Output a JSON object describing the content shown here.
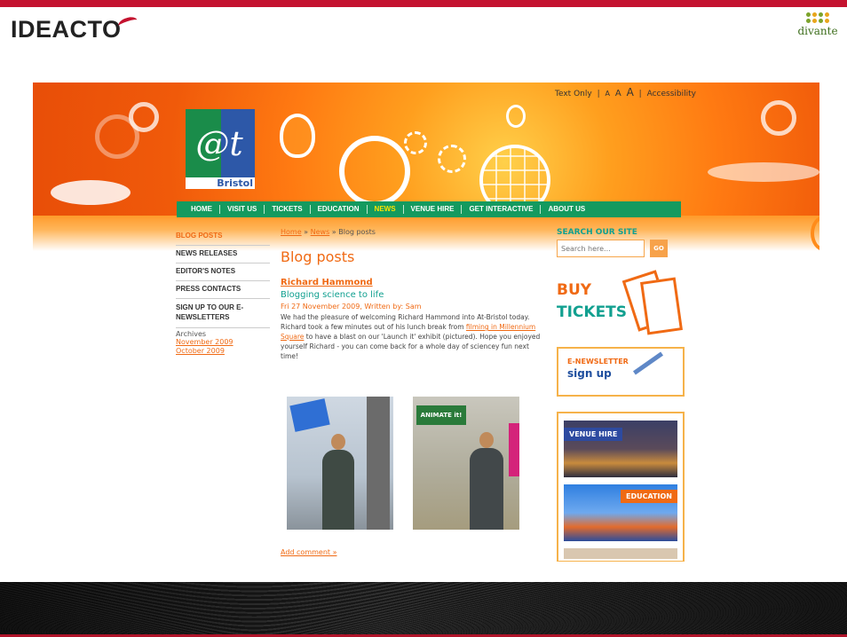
{
  "slide": {
    "logo": "IDEACTO",
    "partner": "divante"
  },
  "site": {
    "access_links": [
      "Text Only",
      "|",
      "A",
      "A",
      "A",
      "|",
      "Accessibility"
    ],
    "logo_mark": "@t",
    "logo_city": "Bristol",
    "nav": [
      "HOME",
      "VISIT US",
      "TICKETS",
      "EDUCATION",
      "NEWS",
      "VENUE HIRE",
      "GET INTERACTIVE",
      "ABOUT US"
    ],
    "active_nav": "NEWS",
    "sidebar": [
      "BLOG POSTS",
      "NEWS RELEASES",
      "EDITOR'S NOTES",
      "PRESS CONTACTS",
      "SIGN UP TO OUR E-NEWSLETTERS"
    ],
    "archives_label": "Archives",
    "archives": [
      "November 2009",
      "October 2009"
    ],
    "breadcrumb": {
      "home": "Home",
      "sep": "»",
      "news": "News",
      "current": "Blog posts"
    },
    "page_heading": "Blog posts",
    "post": {
      "title": "Richard Hammond",
      "subtitle": "Blogging science to life",
      "meta": "Fri 27 November 2009, Written by: Sam",
      "body_1": "We had the pleasure of welcoming Richard Hammond into At-Bristol today. Richard took a few minutes out of his lunch break from ",
      "body_link": "filming in Millennium Square",
      "body_2": " to have a blast on our 'Launch it' exhibit (pictured). Hope you enjoyed yourself Richard - you can come back for a whole day of sciencey fun next time!",
      "photo_sign": "ANIMATE it!",
      "add_comment": "Add comment »"
    },
    "search": {
      "label": "SEARCH OUR SITE",
      "placeholder": "Search here...",
      "button": "GO"
    },
    "buy_tickets": [
      "BUY",
      "TICKETS"
    ],
    "newsletter": [
      "E-NEWSLETTER",
      "sign up"
    ],
    "promos": [
      "VENUE HIRE",
      "EDUCATION"
    ]
  },
  "colors": {
    "brand_red": "#c4122f",
    "site_orange": "#f06a14",
    "site_green": "#149a5f",
    "site_teal": "#12a090",
    "nav_active": "#ffe400"
  }
}
